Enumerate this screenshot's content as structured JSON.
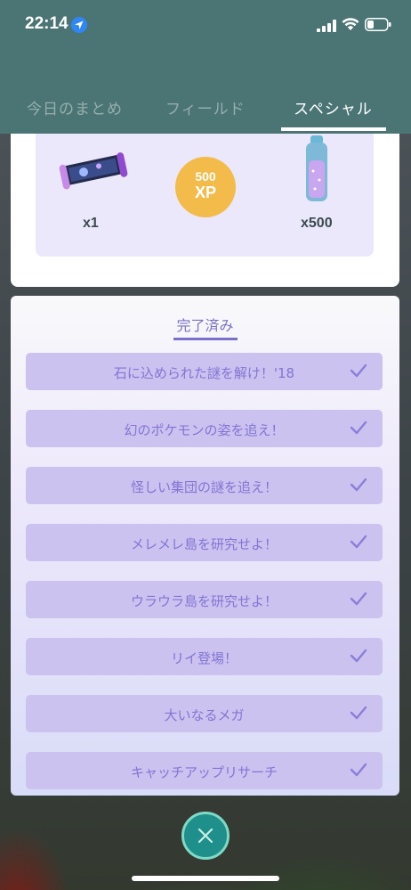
{
  "status_bar": {
    "time": "22:14",
    "icons": [
      "location-arrow-icon",
      "cellular-signal-icon",
      "wifi-icon",
      "battery-icon"
    ]
  },
  "tabs": [
    {
      "label": "今日のまとめ",
      "active": false
    },
    {
      "label": "フィールド",
      "active": false
    },
    {
      "label": "スペシャル",
      "active": true
    }
  ],
  "rewards": {
    "items": [
      {
        "icon": "research-map-scroll-icon",
        "label": "x1"
      },
      {
        "icon": "xp-coin-icon",
        "label_top": "500",
        "label_bottom": "XP"
      },
      {
        "icon": "stardust-potion-icon",
        "label": "x500"
      }
    ]
  },
  "completed": {
    "title": "完了済み",
    "items": [
      "石に込められた謎を解け！'18",
      "幻のポケモンの姿を追え！",
      "怪しい集団の謎を追え！",
      "メレメレ島を研究せよ！",
      "ウラウラ島を研究せよ！",
      "リイ登場！",
      "大いなるメガ",
      "キャッチアップリサーチ"
    ]
  },
  "colors": {
    "header": "#4b7474",
    "accent_purple": "#7a70c9",
    "row_bg": "#cbc2ef",
    "close_button": "#1e8f8b"
  }
}
